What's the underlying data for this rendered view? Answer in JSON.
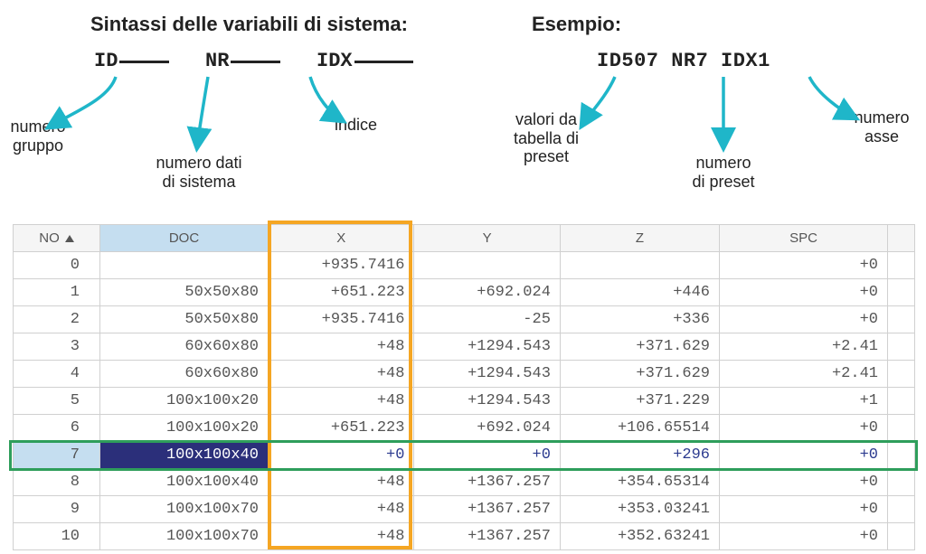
{
  "syntax": {
    "title": "Sintassi delle variabili di sistema:",
    "id_label": "ID",
    "nr_label": "NR",
    "idx_label": "IDX",
    "ann_group": "numero\ngruppo",
    "ann_sysdata": "numero dati\ndi sistema",
    "ann_index": "indice"
  },
  "example": {
    "title": "Esempio:",
    "vars": "ID507  NR7  IDX1",
    "ann_presetvals": "valori da\ntabella di\npreset",
    "ann_presetnum": "numero\ndi preset",
    "ann_axis": "numero\nasse"
  },
  "table": {
    "headers": {
      "no": "NO",
      "doc": "DOC",
      "x": "X",
      "y": "Y",
      "z": "Z",
      "spc": "SPC"
    },
    "rows": [
      {
        "no": "0",
        "doc": "",
        "x": "+935.7416",
        "y": "",
        "z": "",
        "spc": "+0"
      },
      {
        "no": "1",
        "doc": "50x50x80",
        "x": "+651.223",
        "y": "+692.024",
        "z": "+446",
        "spc": "+0"
      },
      {
        "no": "2",
        "doc": "50x50x80",
        "x": "+935.7416",
        "y": "-25",
        "z": "+336",
        "spc": "+0"
      },
      {
        "no": "3",
        "doc": "60x60x80",
        "x": "+48",
        "y": "+1294.543",
        "z": "+371.629",
        "spc": "+2.41"
      },
      {
        "no": "4",
        "doc": "60x60x80",
        "x": "+48",
        "y": "+1294.543",
        "z": "+371.629",
        "spc": "+2.41"
      },
      {
        "no": "5",
        "doc": "100x100x20",
        "x": "+48",
        "y": "+1294.543",
        "z": "+371.229",
        "spc": "+1"
      },
      {
        "no": "6",
        "doc": "100x100x20",
        "x": "+651.223",
        "y": "+692.024",
        "z": "+106.65514",
        "spc": "+0"
      },
      {
        "no": "7",
        "doc": "100x100x40",
        "x": "+0",
        "y": "+0",
        "z": "+296",
        "spc": "+0",
        "selected": true
      },
      {
        "no": "8",
        "doc": "100x100x40",
        "x": "+48",
        "y": "+1367.257",
        "z": "+354.65314",
        "spc": "+0"
      },
      {
        "no": "9",
        "doc": "100x100x70",
        "x": "+48",
        "y": "+1367.257",
        "z": "+353.03241",
        "spc": "+0"
      },
      {
        "no": "10",
        "doc": "100x100x70",
        "x": "+48",
        "y": "+1367.257",
        "z": "+352.63241",
        "spc": "+0"
      }
    ]
  }
}
